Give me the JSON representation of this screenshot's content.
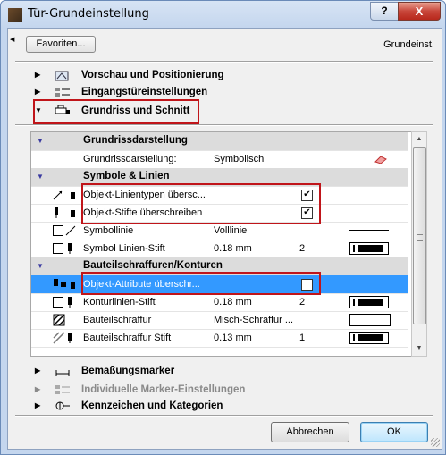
{
  "window": {
    "title": "Tür-Grundeinstellung",
    "help_label": "?",
    "close_label": "X"
  },
  "toolbar": {
    "favorites_label": "Favoriten...",
    "preset_label": "Grundeinst."
  },
  "sections": {
    "vorschau": "Vorschau und Positionierung",
    "eingang": "Eingangstüreinstellungen",
    "grundriss": "Grundriss und Schnitt",
    "bemassung": "Bemaßungsmarker",
    "individuelle": "Individuelle Marker-Einstellungen",
    "kennzeichen": "Kennzeichen und Kategorien"
  },
  "panel": {
    "group1": "Grundrissdarstellung",
    "row_grundriss": {
      "name": "Grundrissdarstellung:",
      "value": "Symbolisch"
    },
    "group2": "Symbole & Linien",
    "row_linientypen": {
      "name": "Objekt-Linientypen übersc...",
      "checked": true
    },
    "row_stifte": {
      "name": "Objekt-Stifte überschreiben",
      "checked": true
    },
    "row_symbollinie": {
      "name": "Symbollinie",
      "value": "Volllinie"
    },
    "row_symbolstift": {
      "name": "Symbol Linien-Stift",
      "value": "0.18 mm",
      "pen": "2"
    },
    "group3": "Bauteilschraffuren/Konturen",
    "row_attribute": {
      "name": "Objekt-Attribute überschr...",
      "checked": true
    },
    "row_kontur": {
      "name": "Konturlinien-Stift",
      "value": "0.18 mm",
      "pen": "2"
    },
    "row_schraffur": {
      "name": "Bauteilschraffur",
      "value": "Misch-Schraffur ..."
    },
    "row_schraffurstift": {
      "name": "Bauteilschraffur Stift",
      "value": "0.13 mm",
      "pen": "1"
    }
  },
  "buttons": {
    "cancel": "Abbrechen",
    "ok": "OK"
  },
  "colors": {
    "highlight": "#3399ff",
    "annotation": "#c0151a",
    "close": "#c8463a"
  },
  "icons": [
    "door-app-icon",
    "preview-icon",
    "entrance-icon",
    "floorplan-icon",
    "dimension-icon",
    "marker-icon",
    "category-icon",
    "linetype-icon",
    "pen-icon",
    "pen-attribute-icon",
    "fill-icon",
    "pen-swatch-icon",
    "hatch-icon"
  ]
}
